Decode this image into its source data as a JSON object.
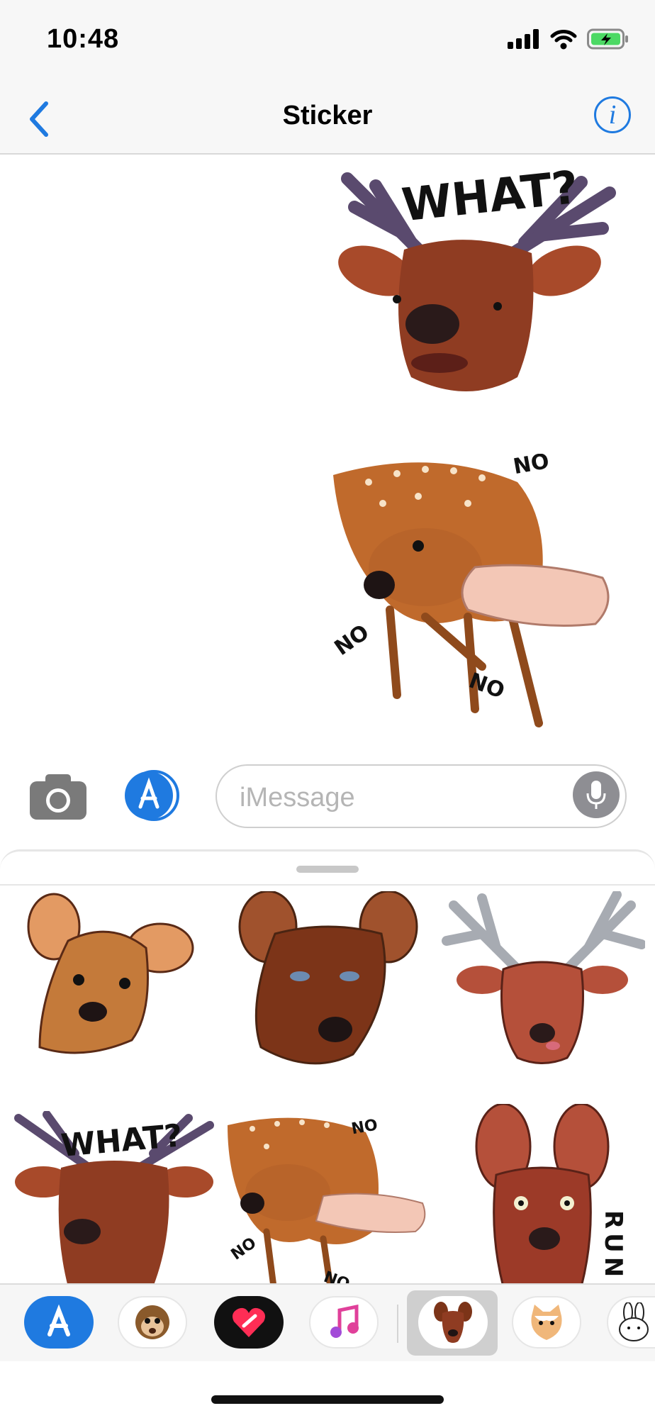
{
  "status_bar": {
    "time": "10:48"
  },
  "nav": {
    "title": "Sticker",
    "info_label": "i"
  },
  "conversation": {
    "stickers": [
      {
        "name": "what-deer",
        "caption": "WHAT?"
      },
      {
        "name": "no-deer",
        "caption_a": "NO",
        "caption_b": "NO",
        "caption_c": "NO"
      }
    ]
  },
  "input": {
    "placeholder": "iMessage",
    "value": ""
  },
  "drawer": {
    "row2": {
      "what_caption": "WHAT?",
      "no_top": "NO",
      "no_left": "NO",
      "no_bottom": "NO",
      "run_caption": "RUN"
    }
  },
  "app_strip": {
    "icons": [
      "app-store-icon",
      "animoji-icon",
      "digital-touch-icon",
      "music-icon",
      "deer-sticker-app-icon",
      "cat-sticker-app-icon",
      "rabbit-sticker-app-icon"
    ]
  },
  "colors": {
    "accent": "#1f7ae0",
    "battery": "#4cd964",
    "deer_brown": "#a0522d",
    "antler": "#5a4a6e"
  }
}
